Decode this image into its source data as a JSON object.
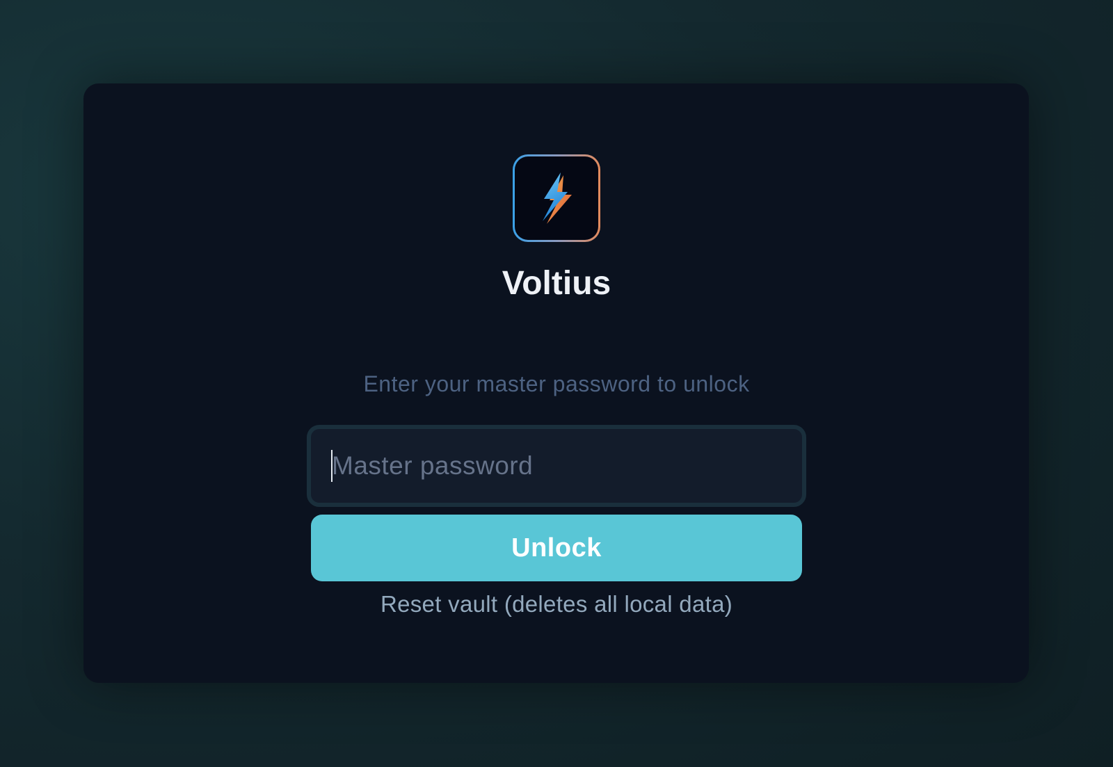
{
  "app": {
    "name": "Voltius",
    "logo_icon": "lightning-bolt-icon",
    "logo_gradient": [
      "#3aa0e8",
      "#e48a5c"
    ]
  },
  "unlock": {
    "instruction": "Enter your master password to unlock",
    "password_placeholder": "Master password",
    "password_value": "",
    "button_label": "Unlock",
    "reset_label": "Reset vault (deletes all local data)"
  },
  "colors": {
    "accent": "#59c6d6",
    "card_background": "#0b121f"
  }
}
